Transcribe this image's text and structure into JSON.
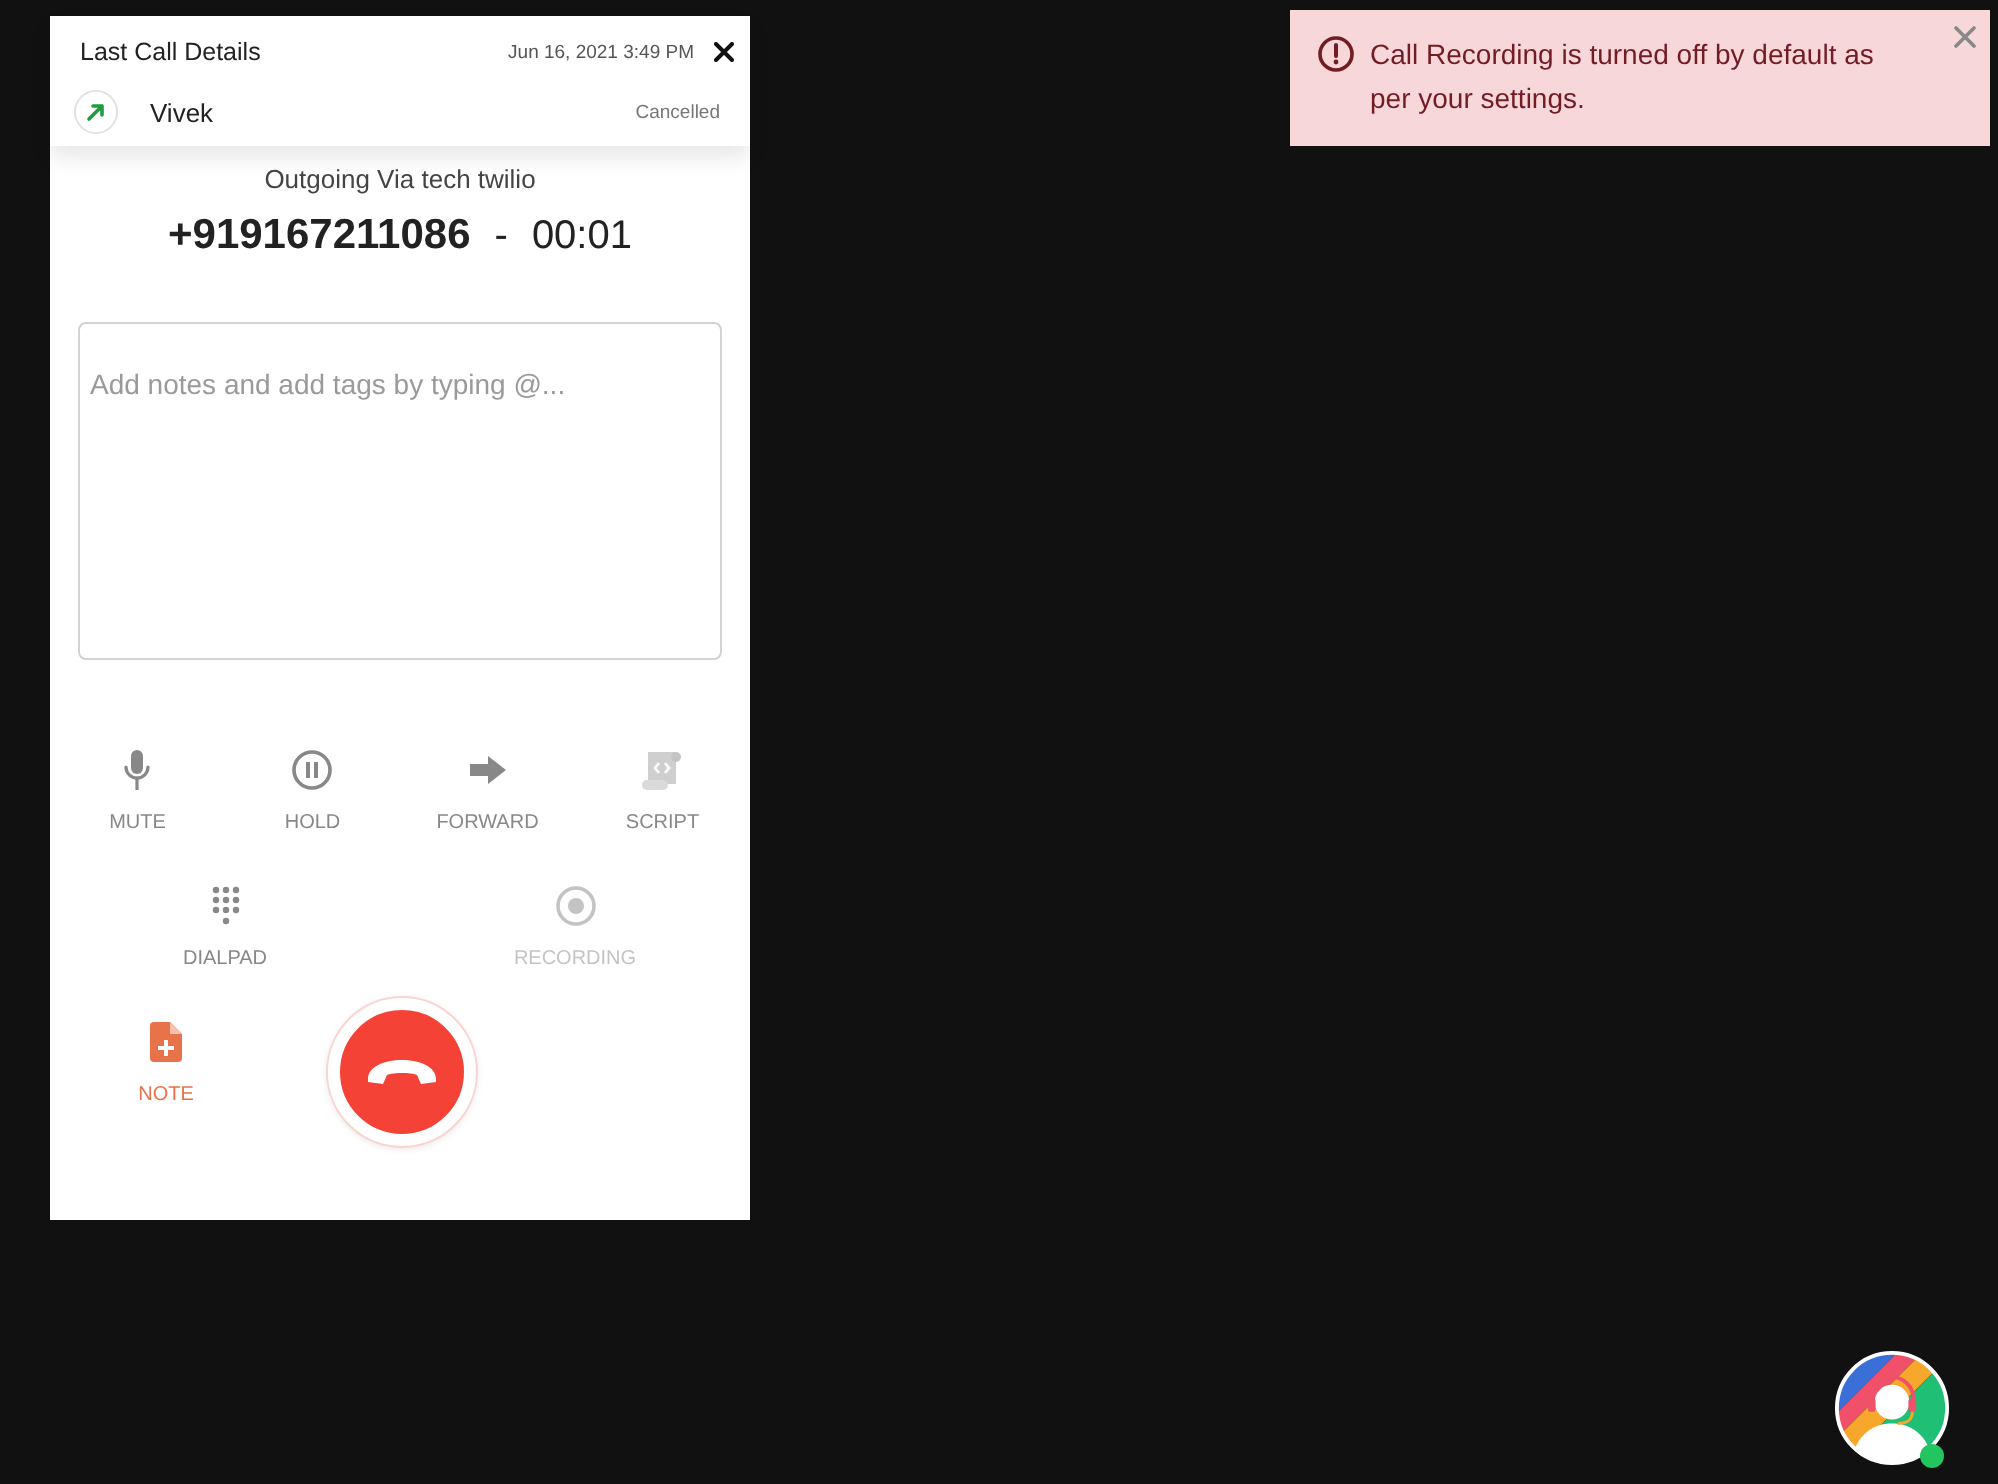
{
  "call_details": {
    "title": "Last Call Details",
    "date": "Jun 16, 2021 3:49 PM",
    "contact": "Vivek",
    "status": "Cancelled"
  },
  "call": {
    "route": "Outgoing Via tech twilio",
    "number": "+919167211086",
    "separator": "-",
    "duration": "00:01"
  },
  "notes": {
    "placeholder": "Add notes and add tags by typing @..."
  },
  "action_rows": [
    {
      "actions": [
        {
          "kind": "mute",
          "label": "MUTE",
          "disabled": false,
          "active": false
        },
        {
          "kind": "hold",
          "label": "HOLD",
          "disabled": false,
          "active": false
        },
        {
          "kind": "forward",
          "label": "FORWARD",
          "disabled": false,
          "active": false
        },
        {
          "kind": "script",
          "label": "SCRIPT",
          "disabled": false,
          "active": false
        }
      ]
    },
    {
      "actions": [
        {
          "kind": "dialpad",
          "label": "DIALPAD",
          "disabled": false,
          "active": false
        },
        {
          "kind": "recording",
          "label": "RECORDING",
          "disabled": true,
          "active": false
        }
      ]
    },
    {
      "actions": [
        {
          "kind": "note",
          "label": "NOTE",
          "disabled": false,
          "active": true
        }
      ]
    }
  ],
  "toast": {
    "message": "Call Recording is turned off by default as per your settings."
  },
  "support_widget": {
    "online": true
  }
}
